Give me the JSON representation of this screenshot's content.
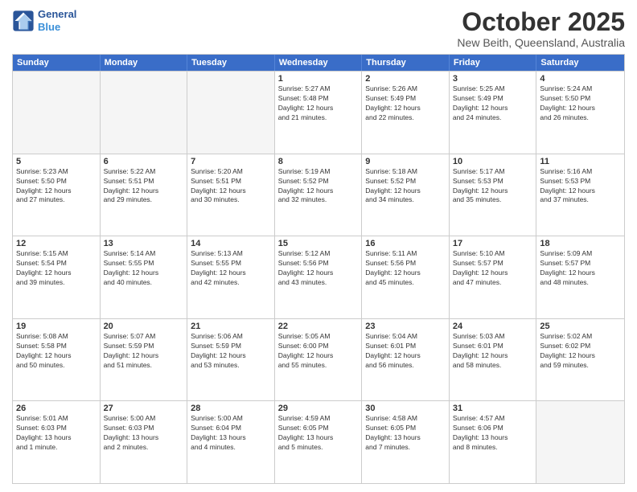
{
  "header": {
    "logo_line1": "General",
    "logo_line2": "Blue",
    "month": "October 2025",
    "location": "New Beith, Queensland, Australia"
  },
  "days_of_week": [
    "Sunday",
    "Monday",
    "Tuesday",
    "Wednesday",
    "Thursday",
    "Friday",
    "Saturday"
  ],
  "rows": [
    [
      {
        "day": "",
        "info": ""
      },
      {
        "day": "",
        "info": ""
      },
      {
        "day": "",
        "info": ""
      },
      {
        "day": "1",
        "info": "Sunrise: 5:27 AM\nSunset: 5:48 PM\nDaylight: 12 hours\nand 21 minutes."
      },
      {
        "day": "2",
        "info": "Sunrise: 5:26 AM\nSunset: 5:49 PM\nDaylight: 12 hours\nand 22 minutes."
      },
      {
        "day": "3",
        "info": "Sunrise: 5:25 AM\nSunset: 5:49 PM\nDaylight: 12 hours\nand 24 minutes."
      },
      {
        "day": "4",
        "info": "Sunrise: 5:24 AM\nSunset: 5:50 PM\nDaylight: 12 hours\nand 26 minutes."
      }
    ],
    [
      {
        "day": "5",
        "info": "Sunrise: 5:23 AM\nSunset: 5:50 PM\nDaylight: 12 hours\nand 27 minutes."
      },
      {
        "day": "6",
        "info": "Sunrise: 5:22 AM\nSunset: 5:51 PM\nDaylight: 12 hours\nand 29 minutes."
      },
      {
        "day": "7",
        "info": "Sunrise: 5:20 AM\nSunset: 5:51 PM\nDaylight: 12 hours\nand 30 minutes."
      },
      {
        "day": "8",
        "info": "Sunrise: 5:19 AM\nSunset: 5:52 PM\nDaylight: 12 hours\nand 32 minutes."
      },
      {
        "day": "9",
        "info": "Sunrise: 5:18 AM\nSunset: 5:52 PM\nDaylight: 12 hours\nand 34 minutes."
      },
      {
        "day": "10",
        "info": "Sunrise: 5:17 AM\nSunset: 5:53 PM\nDaylight: 12 hours\nand 35 minutes."
      },
      {
        "day": "11",
        "info": "Sunrise: 5:16 AM\nSunset: 5:53 PM\nDaylight: 12 hours\nand 37 minutes."
      }
    ],
    [
      {
        "day": "12",
        "info": "Sunrise: 5:15 AM\nSunset: 5:54 PM\nDaylight: 12 hours\nand 39 minutes."
      },
      {
        "day": "13",
        "info": "Sunrise: 5:14 AM\nSunset: 5:55 PM\nDaylight: 12 hours\nand 40 minutes."
      },
      {
        "day": "14",
        "info": "Sunrise: 5:13 AM\nSunset: 5:55 PM\nDaylight: 12 hours\nand 42 minutes."
      },
      {
        "day": "15",
        "info": "Sunrise: 5:12 AM\nSunset: 5:56 PM\nDaylight: 12 hours\nand 43 minutes."
      },
      {
        "day": "16",
        "info": "Sunrise: 5:11 AM\nSunset: 5:56 PM\nDaylight: 12 hours\nand 45 minutes."
      },
      {
        "day": "17",
        "info": "Sunrise: 5:10 AM\nSunset: 5:57 PM\nDaylight: 12 hours\nand 47 minutes."
      },
      {
        "day": "18",
        "info": "Sunrise: 5:09 AM\nSunset: 5:57 PM\nDaylight: 12 hours\nand 48 minutes."
      }
    ],
    [
      {
        "day": "19",
        "info": "Sunrise: 5:08 AM\nSunset: 5:58 PM\nDaylight: 12 hours\nand 50 minutes."
      },
      {
        "day": "20",
        "info": "Sunrise: 5:07 AM\nSunset: 5:59 PM\nDaylight: 12 hours\nand 51 minutes."
      },
      {
        "day": "21",
        "info": "Sunrise: 5:06 AM\nSunset: 5:59 PM\nDaylight: 12 hours\nand 53 minutes."
      },
      {
        "day": "22",
        "info": "Sunrise: 5:05 AM\nSunset: 6:00 PM\nDaylight: 12 hours\nand 55 minutes."
      },
      {
        "day": "23",
        "info": "Sunrise: 5:04 AM\nSunset: 6:01 PM\nDaylight: 12 hours\nand 56 minutes."
      },
      {
        "day": "24",
        "info": "Sunrise: 5:03 AM\nSunset: 6:01 PM\nDaylight: 12 hours\nand 58 minutes."
      },
      {
        "day": "25",
        "info": "Sunrise: 5:02 AM\nSunset: 6:02 PM\nDaylight: 12 hours\nand 59 minutes."
      }
    ],
    [
      {
        "day": "26",
        "info": "Sunrise: 5:01 AM\nSunset: 6:03 PM\nDaylight: 13 hours\nand 1 minute."
      },
      {
        "day": "27",
        "info": "Sunrise: 5:00 AM\nSunset: 6:03 PM\nDaylight: 13 hours\nand 2 minutes."
      },
      {
        "day": "28",
        "info": "Sunrise: 5:00 AM\nSunset: 6:04 PM\nDaylight: 13 hours\nand 4 minutes."
      },
      {
        "day": "29",
        "info": "Sunrise: 4:59 AM\nSunset: 6:05 PM\nDaylight: 13 hours\nand 5 minutes."
      },
      {
        "day": "30",
        "info": "Sunrise: 4:58 AM\nSunset: 6:05 PM\nDaylight: 13 hours\nand 7 minutes."
      },
      {
        "day": "31",
        "info": "Sunrise: 4:57 AM\nSunset: 6:06 PM\nDaylight: 13 hours\nand 8 minutes."
      },
      {
        "day": "",
        "info": ""
      }
    ]
  ]
}
